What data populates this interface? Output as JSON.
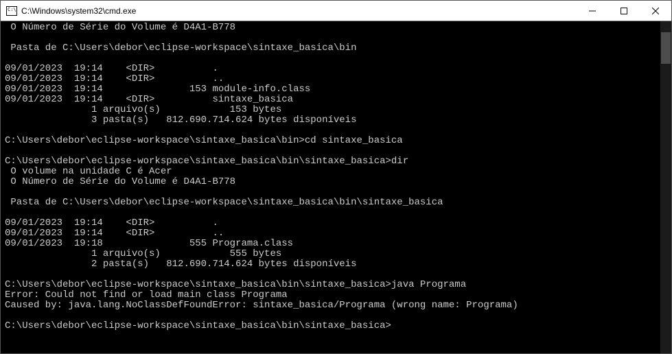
{
  "window": {
    "title": "C:\\Windows\\system32\\cmd.exe"
  },
  "terminal": {
    "lines": [
      " O Número de Série do Volume é D4A1-B778",
      "",
      " Pasta de C:\\Users\\debor\\eclipse-workspace\\sintaxe_basica\\bin",
      "",
      "09/01/2023  19:14    <DIR>          .",
      "09/01/2023  19:14    <DIR>          ..",
      "09/01/2023  19:14               153 module-info.class",
      "09/01/2023  19:14    <DIR>          sintaxe_basica",
      "               1 arquivo(s)            153 bytes",
      "               3 pasta(s)   812.690.714.624 bytes disponíveis",
      "",
      "C:\\Users\\debor\\eclipse-workspace\\sintaxe_basica\\bin>cd sintaxe_basica",
      "",
      "C:\\Users\\debor\\eclipse-workspace\\sintaxe_basica\\bin\\sintaxe_basica>dir",
      " O volume na unidade C é Acer",
      " O Número de Série do Volume é D4A1-B778",
      "",
      " Pasta de C:\\Users\\debor\\eclipse-workspace\\sintaxe_basica\\bin\\sintaxe_basica",
      "",
      "09/01/2023  19:14    <DIR>          .",
      "09/01/2023  19:14    <DIR>          ..",
      "09/01/2023  19:18               555 Programa.class",
      "               1 arquivo(s)            555 bytes",
      "               2 pasta(s)   812.690.714.624 bytes disponíveis",
      "",
      "C:\\Users\\debor\\eclipse-workspace\\sintaxe_basica\\bin\\sintaxe_basica>java Programa",
      "Error: Could not find or load main class Programa",
      "Caused by: java.lang.NoClassDefFoundError: sintaxe_basica/Programa (wrong name: Programa)",
      "",
      "C:\\Users\\debor\\eclipse-workspace\\sintaxe_basica\\bin\\sintaxe_basica>"
    ]
  }
}
